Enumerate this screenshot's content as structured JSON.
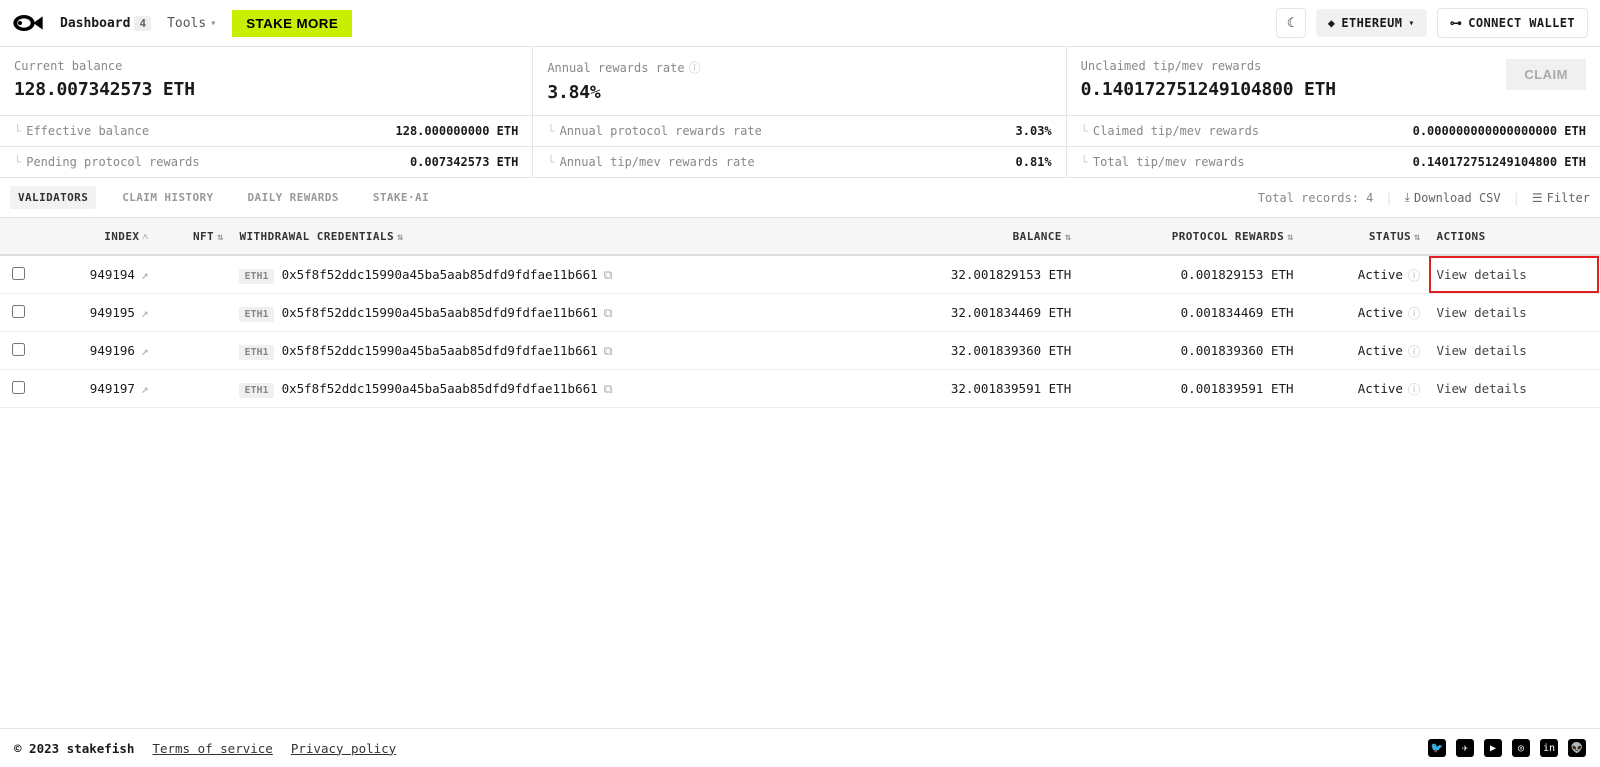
{
  "header": {
    "nav_dashboard": "Dashboard",
    "dashboard_badge": "4",
    "nav_tools": "Tools",
    "stake_more": "STAKE MORE",
    "network": "ETHEREUM",
    "connect": "CONNECT WALLET"
  },
  "stats": {
    "balance_label": "Current balance",
    "balance_value": "128.007342573 ETH",
    "annual_rate_label": "Annual rewards rate",
    "annual_rate_value": "3.84%",
    "unclaimed_label": "Unclaimed tip/mev rewards",
    "unclaimed_value": "0.140172751249104800 ETH",
    "claim_button": "CLAIM",
    "sub": [
      {
        "l": "Effective balance",
        "v": "128.000000000 ETH",
        "l2": "Annual protocol rewards rate",
        "v2": "3.03%",
        "l3": "Claimed tip/mev rewards",
        "v3": "0.000000000000000000 ETH"
      },
      {
        "l": "Pending protocol rewards",
        "v": "0.007342573 ETH",
        "l2": "Annual tip/mev rewards rate",
        "v2": "0.81%",
        "l3": "Total tip/mev rewards",
        "v3": "0.140172751249104800 ETH"
      }
    ]
  },
  "tabs": {
    "validators": "VALIDATORS",
    "claim_history": "CLAIM HISTORY",
    "daily_rewards": "DAILY REWARDS",
    "stake_ai": "STAKE·AI",
    "total_records": "Total records: 4",
    "download": "Download CSV",
    "filter": "Filter"
  },
  "table": {
    "headers": {
      "index": "INDEX",
      "nft": "NFT",
      "withdrawal": "WITHDRAWAL CREDENTIALS",
      "balance": "BALANCE",
      "protocol_rewards": "PROTOCOL REWARDS",
      "status": "STATUS",
      "actions": "ACTIONS"
    },
    "eth_tag": "ETH1",
    "view_details": "View details",
    "rows": [
      {
        "index": "949194",
        "addr": "0x5f8f52ddc15990a45ba5aab85dfd9fdfae11b661",
        "balance": "32.001829153 ETH",
        "rewards": "0.001829153 ETH",
        "status": "Active",
        "hl": true
      },
      {
        "index": "949195",
        "addr": "0x5f8f52ddc15990a45ba5aab85dfd9fdfae11b661",
        "balance": "32.001834469 ETH",
        "rewards": "0.001834469 ETH",
        "status": "Active",
        "hl": false
      },
      {
        "index": "949196",
        "addr": "0x5f8f52ddc15990a45ba5aab85dfd9fdfae11b661",
        "balance": "32.001839360 ETH",
        "rewards": "0.001839360 ETH",
        "status": "Active",
        "hl": false
      },
      {
        "index": "949197",
        "addr": "0x5f8f52ddc15990a45ba5aab85dfd9fdfae11b661",
        "balance": "32.001839591 ETH",
        "rewards": "0.001839591 ETH",
        "status": "Active",
        "hl": false
      }
    ]
  },
  "footer": {
    "copyright": "© 2023 stakefish",
    "terms": "Terms of service",
    "privacy": "Privacy policy"
  }
}
